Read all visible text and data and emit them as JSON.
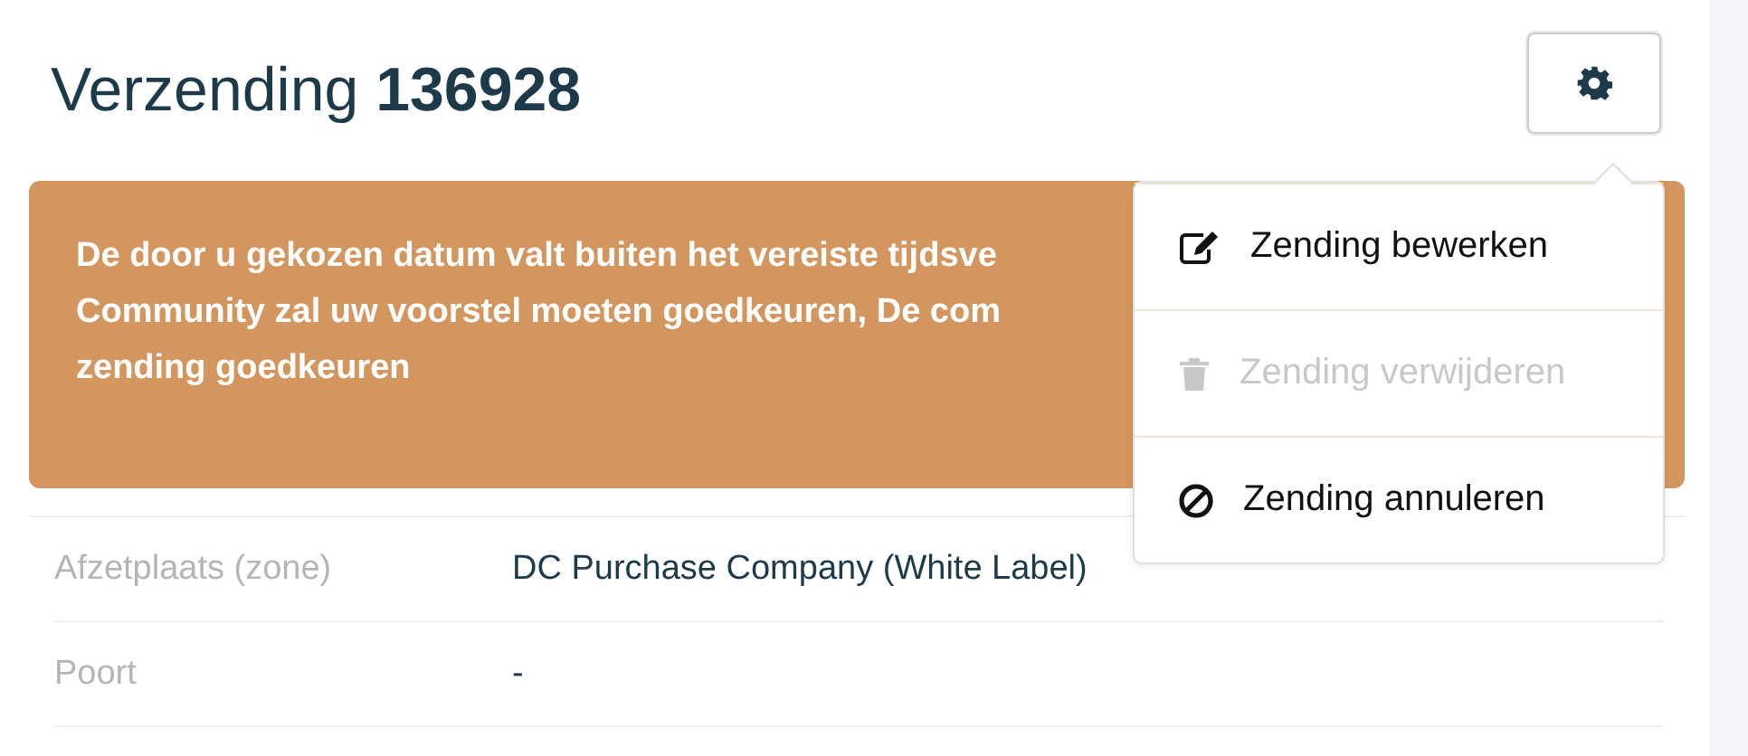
{
  "header": {
    "title": "Verzending",
    "number": "136928"
  },
  "alert": {
    "lines": [
      "De door u gekozen datum valt buiten het vereiste tijdsve",
      "Community zal uw voorstel moeten goedkeuren, De com",
      "zending goedkeuren"
    ]
  },
  "menu": {
    "expanded": true,
    "items": [
      {
        "kind": "edit",
        "label": "Zending bewerken",
        "disabled": false
      },
      {
        "kind": "delete",
        "label": "Zending verwijderen",
        "disabled": true
      },
      {
        "kind": "cancel",
        "label": "Zending annuleren",
        "disabled": false
      }
    ]
  },
  "details": [
    {
      "label": "Afzetplaats (zone)",
      "value": "DC Purchase Company (White Label)"
    },
    {
      "label": "Poort",
      "value": "-"
    }
  ]
}
